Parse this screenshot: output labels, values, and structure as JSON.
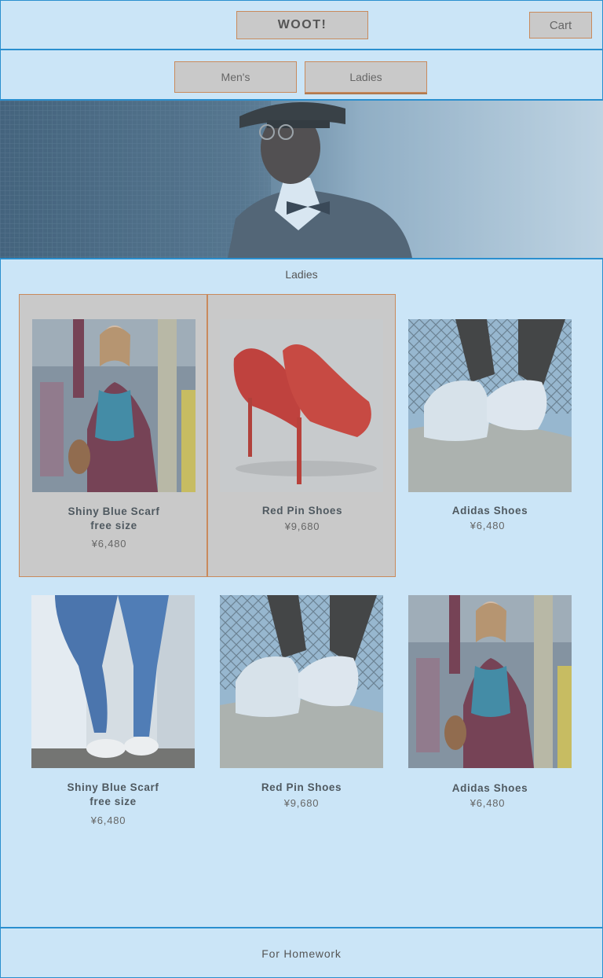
{
  "header": {
    "logo": "WOOT!",
    "cart": "Cart"
  },
  "nav": {
    "mens": "Men's",
    "ladies": "Ladies"
  },
  "section": {
    "title": "Ladies"
  },
  "products": [
    {
      "name": "Shiny Blue Scarf",
      "name2": "free size",
      "price": "¥6,480"
    },
    {
      "name": "Red Pin Shoes",
      "price": "¥9,680"
    },
    {
      "name": "Adidas Shoes",
      "price": "¥6,480"
    },
    {
      "name": "Shiny Blue Scarf",
      "name2": "free size",
      "price": "¥6,480"
    },
    {
      "name": "Red Pin Shoes",
      "price": "¥9,680"
    },
    {
      "name": "Adidas Shoes",
      "price": "¥6,480"
    }
  ],
  "footer": {
    "text": "For Homework"
  },
  "colors": {
    "background": "#cbe5f7",
    "border": "#2a8fcf",
    "button": "#c9c9c9",
    "button_border": "#c98a5c"
  }
}
